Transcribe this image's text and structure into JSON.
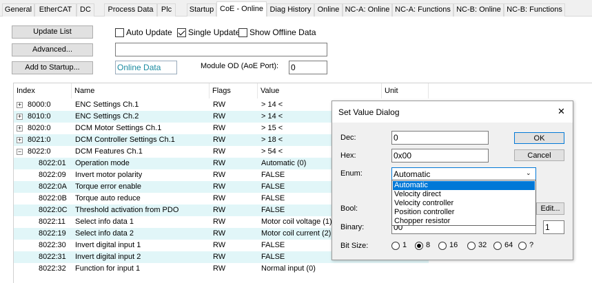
{
  "tabs": [
    {
      "label": "General"
    },
    {
      "label": "EtherCAT"
    },
    {
      "label": "DC"
    },
    {
      "label": "Process Data"
    },
    {
      "label": "Plc"
    },
    {
      "label": "Startup"
    },
    {
      "label": "CoE - Online"
    },
    {
      "label": "Diag History"
    },
    {
      "label": "Online"
    },
    {
      "label": "NC-A: Online"
    },
    {
      "label": "NC-A: Functions"
    },
    {
      "label": "NC-B: Online"
    },
    {
      "label": "NC-B: Functions"
    }
  ],
  "toolbar": {
    "update_list": "Update List",
    "advanced": "Advanced...",
    "add_to_startup": "Add to Startup...",
    "auto_update": "Auto Update",
    "single_update": "Single Update",
    "show_offline": "Show Offline Data",
    "filter_value": "",
    "data_source": "Online Data",
    "module_od_label": "Module OD (AoE Port):",
    "module_od_value": "0"
  },
  "list": {
    "headers": {
      "index": "Index",
      "name": "Name",
      "flags": "Flags",
      "value": "Value",
      "unit": "Unit"
    },
    "rows": [
      {
        "exp": "+",
        "index": "8000:0",
        "name": "ENC Settings Ch.1",
        "flags": "RW",
        "value": "> 14 <"
      },
      {
        "exp": "+",
        "index": "8010:0",
        "name": "ENC Settings Ch.2",
        "flags": "RW",
        "value": "> 14 <"
      },
      {
        "exp": "+",
        "index": "8020:0",
        "name": "DCM Motor Settings Ch.1",
        "flags": "RW",
        "value": "> 15 <"
      },
      {
        "exp": "+",
        "index": "8021:0",
        "name": "DCM Controller Settings Ch.1",
        "flags": "RW",
        "value": "> 18 <"
      },
      {
        "exp": "−",
        "index": "8022:0",
        "name": "DCM Features Ch.1",
        "flags": "RW",
        "value": "> 54 <"
      },
      {
        "index": "8022:01",
        "name": "Operation mode",
        "flags": "RW",
        "value": "Automatic (0)"
      },
      {
        "index": "8022:09",
        "name": "Invert motor polarity",
        "flags": "RW",
        "value": "FALSE"
      },
      {
        "index": "8022:0A",
        "name": "Torque error enable",
        "flags": "RW",
        "value": "FALSE"
      },
      {
        "index": "8022:0B",
        "name": "Torque auto reduce",
        "flags": "RW",
        "value": "FALSE"
      },
      {
        "index": "8022:0C",
        "name": "Threshold activation from PDO",
        "flags": "RW",
        "value": "FALSE"
      },
      {
        "index": "8022:11",
        "name": "Select info data 1",
        "flags": "RW",
        "value": "Motor coil voltage (1)"
      },
      {
        "index": "8022:19",
        "name": "Select info data 2",
        "flags": "RW",
        "value": "Motor coil current (2)"
      },
      {
        "index": "8022:30",
        "name": "Invert digital input 1",
        "flags": "RW",
        "value": "FALSE"
      },
      {
        "index": "8022:31",
        "name": "Invert digital input 2",
        "flags": "RW",
        "value": "FALSE"
      },
      {
        "index": "8022:32",
        "name": "Function for input 1",
        "flags": "RW",
        "value": "Normal input (0)"
      }
    ]
  },
  "dialog": {
    "title": "Set Value Dialog",
    "close": "✕",
    "dec_label": "Dec:",
    "dec_value": "0",
    "hex_label": "Hex:",
    "hex_value": "0x00",
    "enum_label": "Enum:",
    "enum_value": "Automatic",
    "enum_options": [
      "Automatic",
      "Velocity direct",
      "Velocity controller",
      "Position controller",
      "Chopper resistor"
    ],
    "bool_label": "Bool:",
    "binary_label": "Binary:",
    "binary_value": "00",
    "binary_size": "1",
    "bitsize_label": "Bit Size:",
    "bitsizes": [
      "1",
      "8",
      "16",
      "32",
      "64",
      "?"
    ],
    "ok": "OK",
    "cancel": "Cancel",
    "edit": "Edit..."
  }
}
